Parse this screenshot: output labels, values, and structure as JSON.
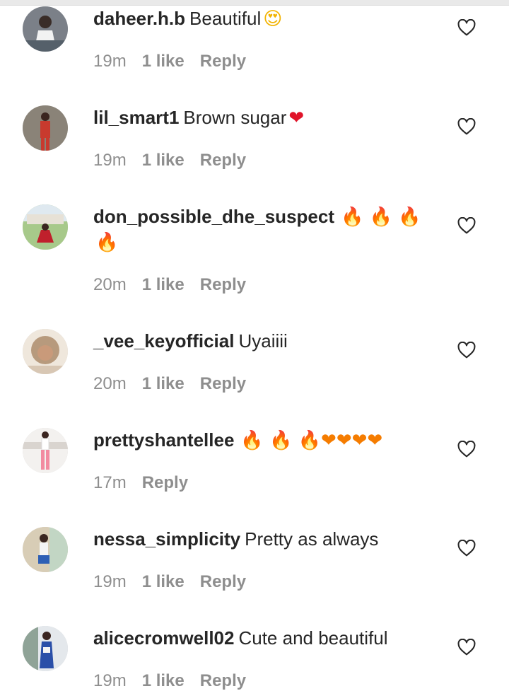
{
  "colors": {
    "text": "#262626",
    "muted": "#8e8e8e",
    "heart": "#e0142a",
    "fire": "#f57c00"
  },
  "comments": [
    {
      "username": "daheer.h.b",
      "text": "Beautiful",
      "emojis": "😍",
      "time": "19m",
      "likes": "1 like",
      "reply": "Reply",
      "avatar_color": "#6b6f7a"
    },
    {
      "username": "lil_smart1",
      "text": "Brown sugar",
      "emojis": "❤",
      "time": "19m",
      "likes": "1 like",
      "reply": "Reply",
      "avatar_color": "#b8332b"
    },
    {
      "username": "don_possible_dhe_suspect",
      "text": "",
      "emojis": "🔥 🔥 🔥",
      "emojis2": "🔥",
      "time": "20m",
      "likes": "1 like",
      "reply": "Reply",
      "avatar_color": "#8aa46c"
    },
    {
      "username": "_vee_keyofficial",
      "text": "Uyaiiii",
      "emojis": "",
      "time": "20m",
      "likes": "1 like",
      "reply": "Reply",
      "avatar_color": "#c9a98c"
    },
    {
      "username": "prettyshantellee",
      "text": "",
      "emojis": "🔥 🔥 🔥❤❤❤❤",
      "time": "17m",
      "likes": "",
      "reply": "Reply",
      "avatar_color": "#e9e4e4"
    },
    {
      "username": "nessa_simplicity",
      "text": "Pretty as always",
      "emojis": "",
      "time": "19m",
      "likes": "1 like",
      "reply": "Reply",
      "avatar_color": "#c8b99a"
    },
    {
      "username": "alicecromwell02",
      "text": "Cute and beautiful",
      "emojis": "",
      "time": "19m",
      "likes": "1 like",
      "reply": "Reply",
      "avatar_color": "#9fb0c4"
    }
  ]
}
